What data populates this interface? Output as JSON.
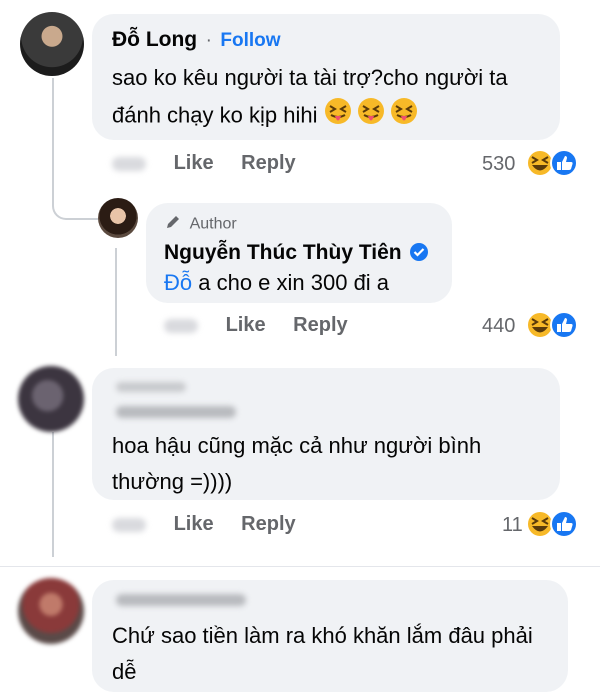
{
  "comment1": {
    "author": "Đỗ Long",
    "separator": "·",
    "follow_label": "Follow",
    "text": "sao ko kêu người ta tài trợ?cho người ta đánh chạy ko kịp hihi",
    "like_label": "Like",
    "reply_label": "Reply",
    "reaction_count": "530"
  },
  "reply1": {
    "badge_label": "Author",
    "author": "Nguyễn Thúc Thùy Tiên",
    "mention": "Đỗ",
    "text": " a cho e xin 300 đi a",
    "like_label": "Like",
    "reply_label": "Reply",
    "reaction_count": "440"
  },
  "comment2": {
    "text": "hoa hậu cũng mặc cả như người bình thường =))))",
    "like_label": "Like",
    "reply_label": "Reply",
    "reaction_count": "11"
  },
  "comment3": {
    "text": "Chứ sao tiền làm ra khó khăn lắm đâu phải dễ"
  },
  "colors": {
    "accent": "#1877f2",
    "bubble": "#f0f2f5",
    "muted": "#65676b",
    "verified": "#1877f2"
  },
  "icons": [
    "tongue-out-emoji",
    "laugh-reaction-icon",
    "like-reaction-icon",
    "pencil-icon",
    "verified-badge-icon"
  ]
}
